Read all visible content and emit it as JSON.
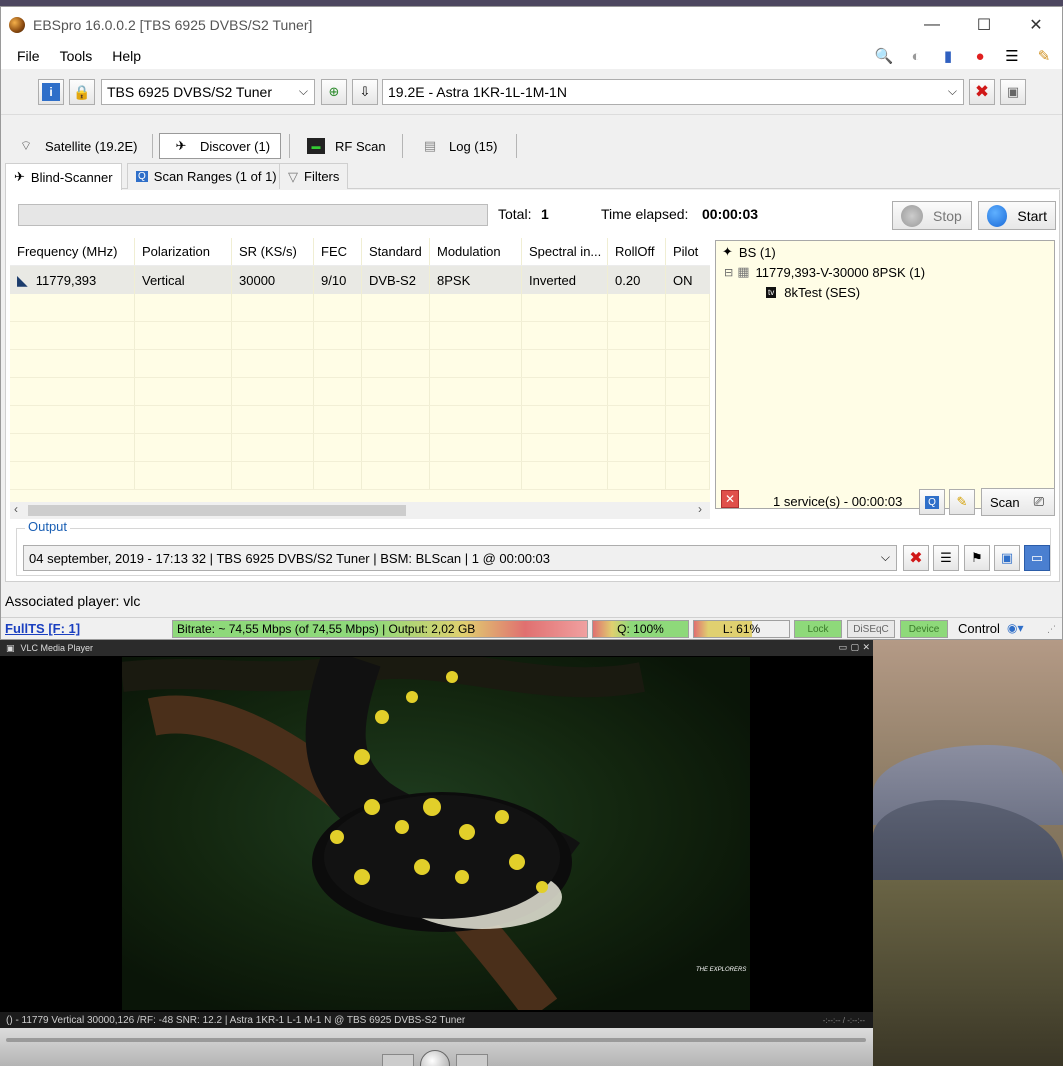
{
  "window": {
    "title": "EBSpro 16.0.0.2 [TBS 6925 DVBS/S2 Tuner]",
    "minimize": "—",
    "maximize": "☐",
    "close": "✕"
  },
  "menu": [
    "File",
    "Tools",
    "Help"
  ],
  "toolbar": {
    "tuner_select": "TBS 6925 DVBS/S2 Tuner",
    "satellite_select": "19.2E - Astra 1KR-1L-1M-1N"
  },
  "main_tabs": [
    {
      "label": "Satellite (19.2E)"
    },
    {
      "label": "Discover (1)"
    },
    {
      "label": "RF Scan"
    },
    {
      "label": "Log (15)"
    }
  ],
  "sub_tabs": [
    {
      "label": "Blind-Scanner"
    },
    {
      "label": "Scan Ranges (1 of 1)"
    },
    {
      "label": "Filters"
    }
  ],
  "scan": {
    "total_label": "Total:",
    "total_value": "1",
    "elapsed_label": "Time elapsed:",
    "elapsed_value": "00:00:03",
    "stop_label": "Stop",
    "start_label": "Start"
  },
  "table": {
    "headers": [
      "Frequency (MHz)",
      "Polarization",
      "SR (KS/s)",
      "FEC",
      "Standard",
      "Modulation",
      "Spectral in...",
      "RollOff",
      "Pilot"
    ],
    "rows": [
      [
        "11779,393",
        "Vertical",
        "30000",
        "9/10",
        "DVB-S2",
        "8PSK",
        "Inverted",
        "0.20",
        "ON"
      ]
    ]
  },
  "tree": {
    "root": "BS (1)",
    "transponder": "11779,393-V-30000 8PSK (1)",
    "service": "8kTest (SES)",
    "expand_glyph": "⊟"
  },
  "tree_footer": {
    "services": "1 service(s) - 00:00:03",
    "scan_label": "Scan"
  },
  "output": {
    "legend": "Output",
    "value": "04 september, 2019 - 17:13 32 | TBS 6925 DVBS/S2 Tuner | BSM: BLScan | 1 @ 00:00:03"
  },
  "associated_player": "Associated player: vlc",
  "statusbar": {
    "fullts": "FullTS [F: 1]",
    "bitrate": "Bitrate: ~ 74,55 Mbps (of 74,55 Mbps) | Output: 2,02 GB",
    "quality": "Q: 100%",
    "level": "L: 61%",
    "lock": "Lock",
    "diseqc": "DiSEqC",
    "device": "Device",
    "control": "Control"
  },
  "vlc": {
    "title": "VLC Media Player",
    "status": "() - 11779 Vertical 30000,126 /RF: -48 SNR: 12.2 | Astra 1KR-1 L-1 M-1 N @ TBS 6925 DVBS-S2 Tuner",
    "time": "-:--:-- / -:--:--",
    "watermark": "THE EXPLORERS"
  },
  "colors": {
    "accent": "#1a5fb4",
    "status_green": "#7ed36a",
    "status_red": "#e06060",
    "grid_bg": "#fffde6"
  }
}
